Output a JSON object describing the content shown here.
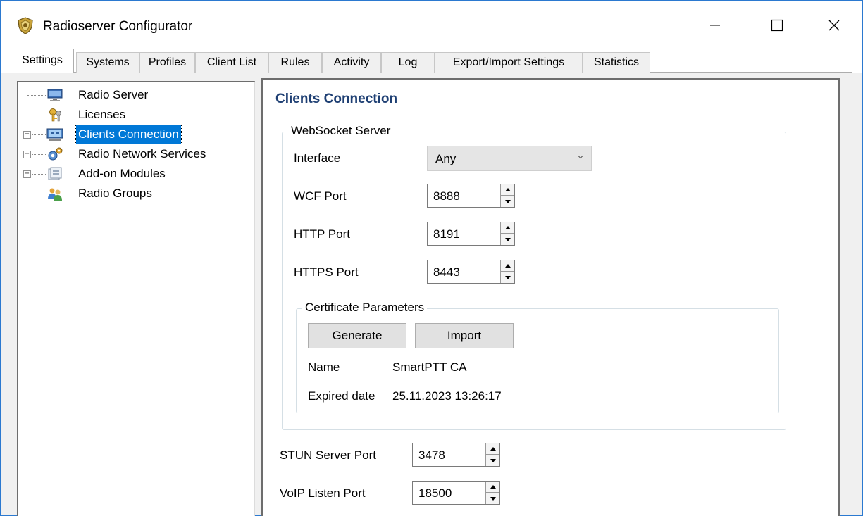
{
  "window": {
    "title": "Radioserver Configurator",
    "minimize_icon": "minimize-icon",
    "maximize_icon": "maximize-icon",
    "close_icon": "close-icon"
  },
  "tabs": [
    {
      "label": "Settings",
      "active": true
    },
    {
      "label": "Systems"
    },
    {
      "label": "Profiles"
    },
    {
      "label": "Client List"
    },
    {
      "label": "Rules"
    },
    {
      "label": "Activity"
    },
    {
      "label": "Log"
    },
    {
      "label": "Export/Import Settings"
    },
    {
      "label": "Statistics"
    }
  ],
  "tree": {
    "items": [
      {
        "label": "Radio Server",
        "icon": "server-icon",
        "expandable": false
      },
      {
        "label": "Licenses",
        "icon": "keys-icon",
        "expandable": false
      },
      {
        "label": "Clients Connection",
        "icon": "network-icon",
        "expandable": true,
        "selected": true
      },
      {
        "label": "Radio Network Services",
        "icon": "services-gear-icon",
        "expandable": true
      },
      {
        "label": "Add-on Modules",
        "icon": "modules-icon",
        "expandable": true
      },
      {
        "label": "Radio Groups",
        "icon": "users-icon",
        "expandable": false
      }
    ]
  },
  "content": {
    "title": "Clients Connection",
    "websocket": {
      "legend": "WebSocket Server",
      "interface_label": "Interface",
      "interface_value": "Any",
      "wcf_label": "WCF Port",
      "wcf_value": "8888",
      "http_label": "HTTP Port",
      "http_value": "8191",
      "https_label": "HTTPS Port",
      "https_value": "8443"
    },
    "certificate": {
      "legend": "Certificate Parameters",
      "generate_label": "Generate",
      "import_label": "Import",
      "name_label": "Name",
      "name_value": "SmartPTT CA",
      "expired_label": "Expired date",
      "expired_value": "25.11.2023 13:26:17"
    },
    "stun_label": "STUN Server Port",
    "stun_value": "3478",
    "voip_label": "VoIP Listen Port",
    "voip_value": "18500"
  },
  "colors": {
    "selection": "#0078d7",
    "section_title": "#1e3f73",
    "window_border": "#2b79d0"
  }
}
